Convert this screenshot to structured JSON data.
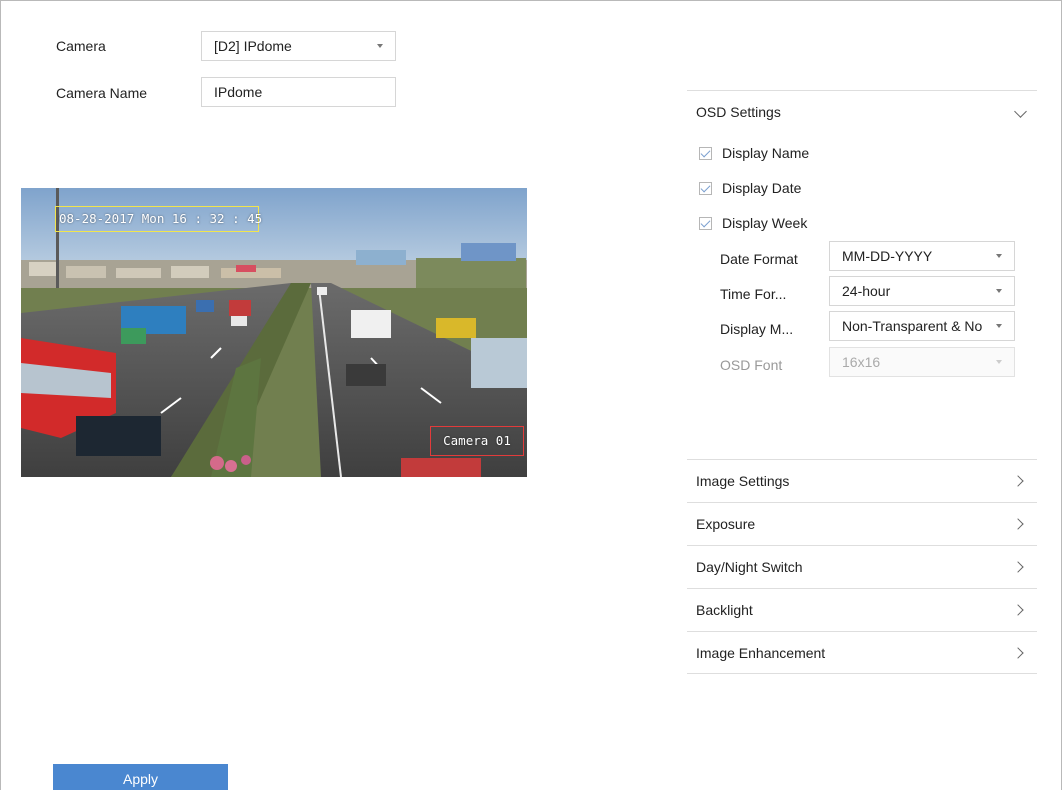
{
  "camera": {
    "label": "Camera",
    "selected": "[D2] IPdome"
  },
  "camera_name": {
    "label": "Camera Name",
    "value": "IPdome"
  },
  "preview": {
    "osd_date_text": "08-28-2017  Mon 16 : 32 : 45",
    "osd_camera_text": "Camera 01",
    "date_box_color": "#f1e54d",
    "name_box_color": "#e23b3b"
  },
  "osd_settings": {
    "title": "OSD Settings",
    "checks": [
      {
        "label": "Display Name",
        "checked": true
      },
      {
        "label": "Display Date",
        "checked": true
      },
      {
        "label": "Display Week",
        "checked": true
      }
    ],
    "fields": [
      {
        "label": "Date Format",
        "value": "MM-DD-YYYY",
        "disabled": false
      },
      {
        "label": "Time For...",
        "value": "24-hour",
        "disabled": false
      },
      {
        "label": "Display M...",
        "value": "Non-Transparent & No",
        "disabled": false
      },
      {
        "label": "OSD Font",
        "value": "16x16",
        "disabled": true
      }
    ]
  },
  "sections": [
    {
      "title": "Image Settings"
    },
    {
      "title": "Exposure"
    },
    {
      "title": "Day/Night Switch"
    },
    {
      "title": "Backlight"
    },
    {
      "title": "Image Enhancement"
    }
  ],
  "apply_label": "Apply",
  "colors": {
    "accent": "#4a87d0",
    "checkmark": "#7a9fcf"
  }
}
